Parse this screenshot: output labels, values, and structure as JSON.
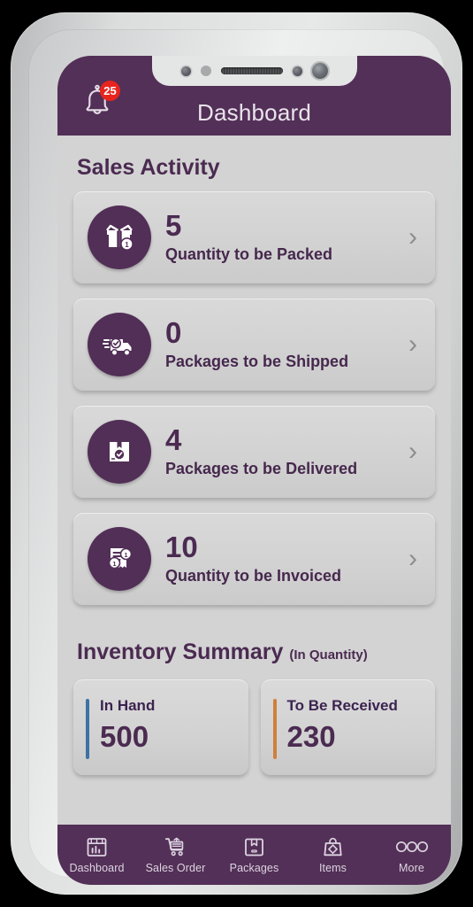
{
  "header": {
    "title": "Dashboard",
    "bell_icon": "bell-icon",
    "notification_count": "25",
    "bar_color": "#533057",
    "badge_color": "#e8241f"
  },
  "sales_activity": {
    "section_title": "Sales Activity",
    "chevron": "›",
    "cards": [
      {
        "value": "5",
        "label": "Quantity to be Packed",
        "icon": "open-box-icon"
      },
      {
        "value": "0",
        "label": "Packages to be Shipped",
        "icon": "delivery-truck-icon"
      },
      {
        "value": "4",
        "label": "Packages to be Delivered",
        "icon": "box-check-icon"
      },
      {
        "value": "10",
        "label": "Quantity to be Invoiced",
        "icon": "invoice-coins-icon"
      }
    ]
  },
  "inventory_summary": {
    "section_title": "Inventory Summary",
    "section_suffix": "(In Quantity)",
    "cards": [
      {
        "label": "In Hand",
        "value": "500",
        "accent": "#3d72a4"
      },
      {
        "label": "To Be Received",
        "value": "230",
        "accent": "#d0803a"
      }
    ]
  },
  "bottom_nav": {
    "items": [
      {
        "label": "Dashboard",
        "icon": "dashboard-chart-icon"
      },
      {
        "label": "Sales Order",
        "icon": "shopping-cart-icon"
      },
      {
        "label": "Packages",
        "icon": "package-box-icon"
      },
      {
        "label": "Items",
        "icon": "shopping-bag-icon"
      },
      {
        "label": "More",
        "icon": "more-dots-icon"
      }
    ]
  }
}
